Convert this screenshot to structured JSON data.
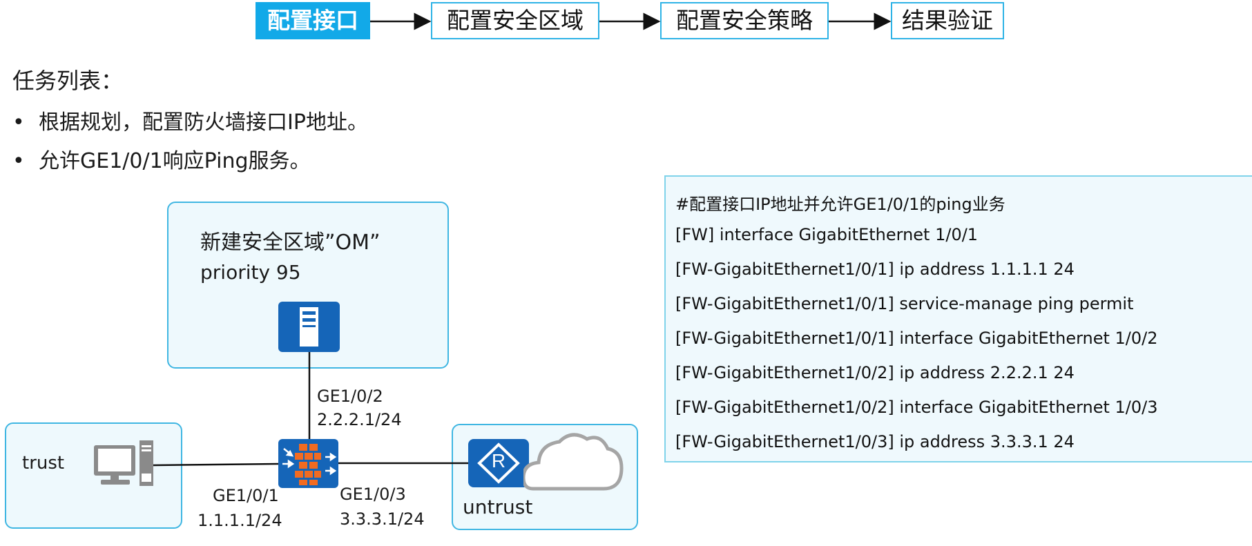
{
  "steps": [
    {
      "label": "配置接口",
      "active": true
    },
    {
      "label": "配置安全区域",
      "active": false
    },
    {
      "label": "配置安全策略",
      "active": false
    },
    {
      "label": "结果验证",
      "active": false
    }
  ],
  "tasks": {
    "title": "任务列表：",
    "items": [
      "根据规划，配置防火墙接口IP地址。",
      "允许GE1/0/1响应Ping服务。"
    ]
  },
  "topology": {
    "om_zone": {
      "title": "新建安全区域”OM”",
      "priority": "priority 95"
    },
    "trust_zone": {
      "label": "trust"
    },
    "untrust_zone": {
      "label": "untrust"
    },
    "ports": {
      "ge2_name": "GE1/0/2",
      "ge2_ip": "2.2.2.1/24",
      "ge1_name": "GE1/0/1",
      "ge1_ip": "1.1.1.1/24",
      "ge3_name": "GE1/0/3",
      "ge3_ip": "3.3.3.1/24"
    },
    "router_letter": "R"
  },
  "commands": {
    "comment": "#配置接口IP地址并允许GE1/0/1的ping业务",
    "lines": [
      "[FW] interface GigabitEthernet 1/0/1",
      "[FW-GigabitEthernet1/0/1] ip address 1.1.1.1 24",
      "[FW-GigabitEthernet1/0/1] service-manage ping permit",
      "[FW-GigabitEthernet1/0/1] interface GigabitEthernet 1/0/2",
      "[FW-GigabitEthernet1/0/2] ip address 2.2.2.1 24",
      "[FW-GigabitEthernet1/0/2] interface GigabitEthernet 1/0/3",
      "[FW-GigabitEthernet1/0/3] ip address 3.3.3.1 24"
    ]
  },
  "colors": {
    "accent": "#12a9e8",
    "zone_border": "#3fb6e2",
    "zone_fill": "#eef9fd",
    "device_blue": "#1565b8",
    "firewall_brick": "#f26b21"
  }
}
